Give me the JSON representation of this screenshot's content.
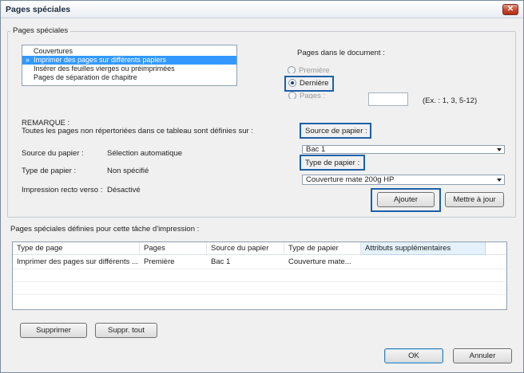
{
  "window": {
    "title": "Pages spéciales",
    "close_glyph": "✕"
  },
  "group": {
    "label": "Pages spéciales"
  },
  "page_types": {
    "items": [
      {
        "label": "Couvertures",
        "selected": false
      },
      {
        "label": "Imprimer des pages sur différents papiers",
        "selected": true
      },
      {
        "label": "Insérer des feuilles vierges ou préimprimées",
        "selected": false
      },
      {
        "label": "Pages de séparation de chapitre",
        "selected": false
      }
    ],
    "selected_marker": "»"
  },
  "pages_in_document": {
    "label": "Pages dans le document :",
    "options": [
      {
        "label": "Première",
        "checked": false
      },
      {
        "label": "Dernière",
        "checked": true
      },
      {
        "label": "Pages :",
        "checked": false
      }
    ],
    "pages_value": "",
    "example": "(Ex. : 1, 3, 5-12)"
  },
  "remark": {
    "title": "REMARQUE :",
    "text": "Toutes les pages non répertoriées dans ce tableau sont définies sur :",
    "rows": [
      {
        "label": "Source du papier :",
        "value": "Sélection automatique"
      },
      {
        "label": "Type de papier :",
        "value": "Non spécifié"
      },
      {
        "label": "Impression recto verso :",
        "value": "Désactivé"
      }
    ]
  },
  "paper_source": {
    "label": "Source de papier :",
    "value": "Bac 1"
  },
  "paper_type": {
    "label": "Type de papier :",
    "value": "Couverture mate 200g HP"
  },
  "actions": {
    "add": "Ajouter",
    "update": "Mettre à jour"
  },
  "defined_pages": {
    "label": "Pages spéciales définies pour cette tâche d'impression :",
    "columns": [
      "Type de page",
      "Pages",
      "Source du papier",
      "Type de papier",
      "Attributs supplémentaires"
    ],
    "rows": [
      [
        "Imprimer des pages sur différents ...",
        "Première",
        "Bac 1",
        "Couverture mate...",
        ""
      ]
    ]
  },
  "table_actions": {
    "delete": "Supprimer",
    "delete_all": "Suppr. tout"
  },
  "footer": {
    "ok": "OK",
    "cancel": "Annuler"
  }
}
